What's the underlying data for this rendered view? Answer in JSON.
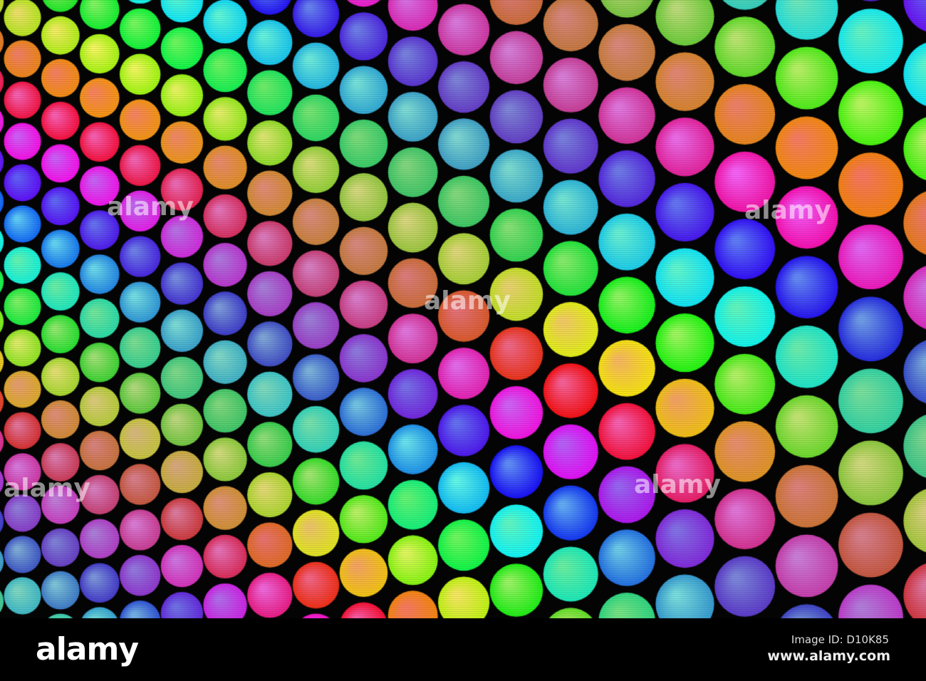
{
  "watermark": {
    "logo": "alamy",
    "image_id": "Image ID: D10K85",
    "site": "www.alamy.com"
  }
}
